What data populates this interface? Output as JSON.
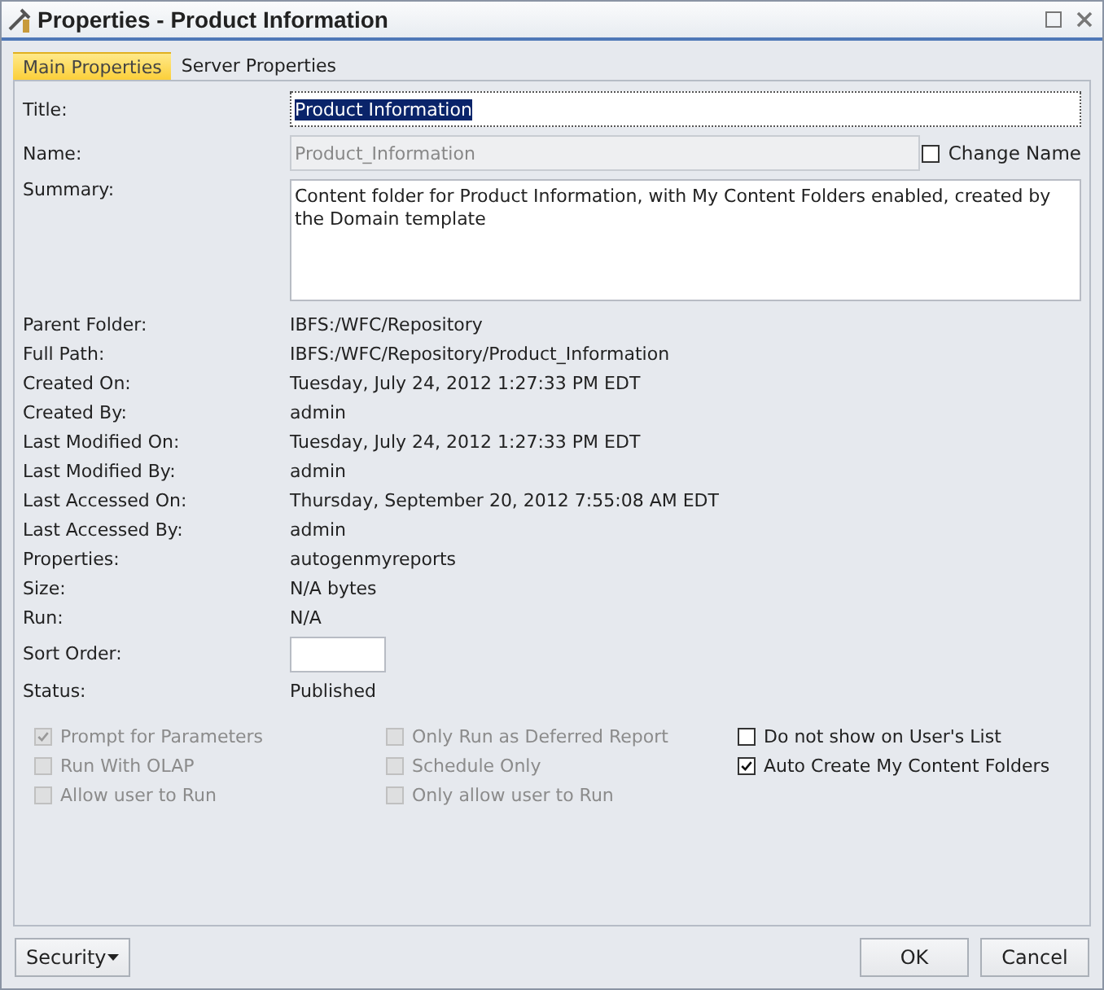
{
  "window": {
    "title": "Properties - Product Information"
  },
  "tabs": [
    {
      "label": "Main Properties",
      "selected": true
    },
    {
      "label": "Server Properties",
      "selected": false
    }
  ],
  "title_field": {
    "label": "Title:",
    "value": "Product Information",
    "highlighted": true
  },
  "name_field": {
    "label": "Name:",
    "value": "Product_Information",
    "disabled": true,
    "change_name": {
      "label": "Change Name",
      "checked": false
    }
  },
  "summary_field": {
    "label": "Summary:",
    "value": "Content folder for Product Information, with My Content Folders enabled, created by the Domain template"
  },
  "info_rows": [
    {
      "kind": "text",
      "label": "Parent Folder:",
      "value": "IBFS:/WFC/Repository"
    },
    {
      "kind": "text",
      "label": "Full Path:",
      "value": "IBFS:/WFC/Repository/Product_Information"
    },
    {
      "kind": "text",
      "label": "Created On:",
      "value": "Tuesday, July 24, 2012 1:27:33 PM EDT"
    },
    {
      "kind": "text",
      "label": "Created By:",
      "value": "admin"
    },
    {
      "kind": "text",
      "label": "Last Modified On:",
      "value": "Tuesday, July 24, 2012 1:27:33 PM EDT"
    },
    {
      "kind": "text",
      "label": "Last Modified By:",
      "value": "admin"
    },
    {
      "kind": "text",
      "label": "Last Accessed On:",
      "value": "Thursday, September 20, 2012 7:55:08 AM EDT"
    },
    {
      "kind": "text",
      "label": "Last Accessed By:",
      "value": "admin"
    },
    {
      "kind": "text",
      "label": "Properties:",
      "value": "autogenmyreports"
    },
    {
      "kind": "text",
      "label": "Size:",
      "value": "N/A bytes"
    },
    {
      "kind": "text",
      "label": "Run:",
      "value": "N/A"
    },
    {
      "kind": "input",
      "label": "Sort Order:"
    },
    {
      "kind": "text",
      "label": "Status:",
      "value": "Published"
    }
  ],
  "option_columns": [
    [
      {
        "label": "Prompt for Parameters",
        "checked": true,
        "disabled": true
      },
      {
        "label": "Run With OLAP",
        "checked": false,
        "disabled": true
      },
      {
        "label": "Allow user to Run",
        "checked": false,
        "disabled": true
      }
    ],
    [
      {
        "label": "Only Run as Deferred Report",
        "checked": false,
        "disabled": true
      },
      {
        "label": "Schedule Only",
        "checked": false,
        "disabled": true
      },
      {
        "label": "Only allow user to Run",
        "checked": false,
        "disabled": true
      }
    ],
    [
      {
        "label": "Do not show on User's List",
        "checked": false,
        "disabled": false
      },
      {
        "label": "Auto Create My Content Folders",
        "checked": true,
        "disabled": false
      }
    ]
  ],
  "buttons": {
    "security": "Security",
    "ok": "OK",
    "cancel": "Cancel"
  }
}
